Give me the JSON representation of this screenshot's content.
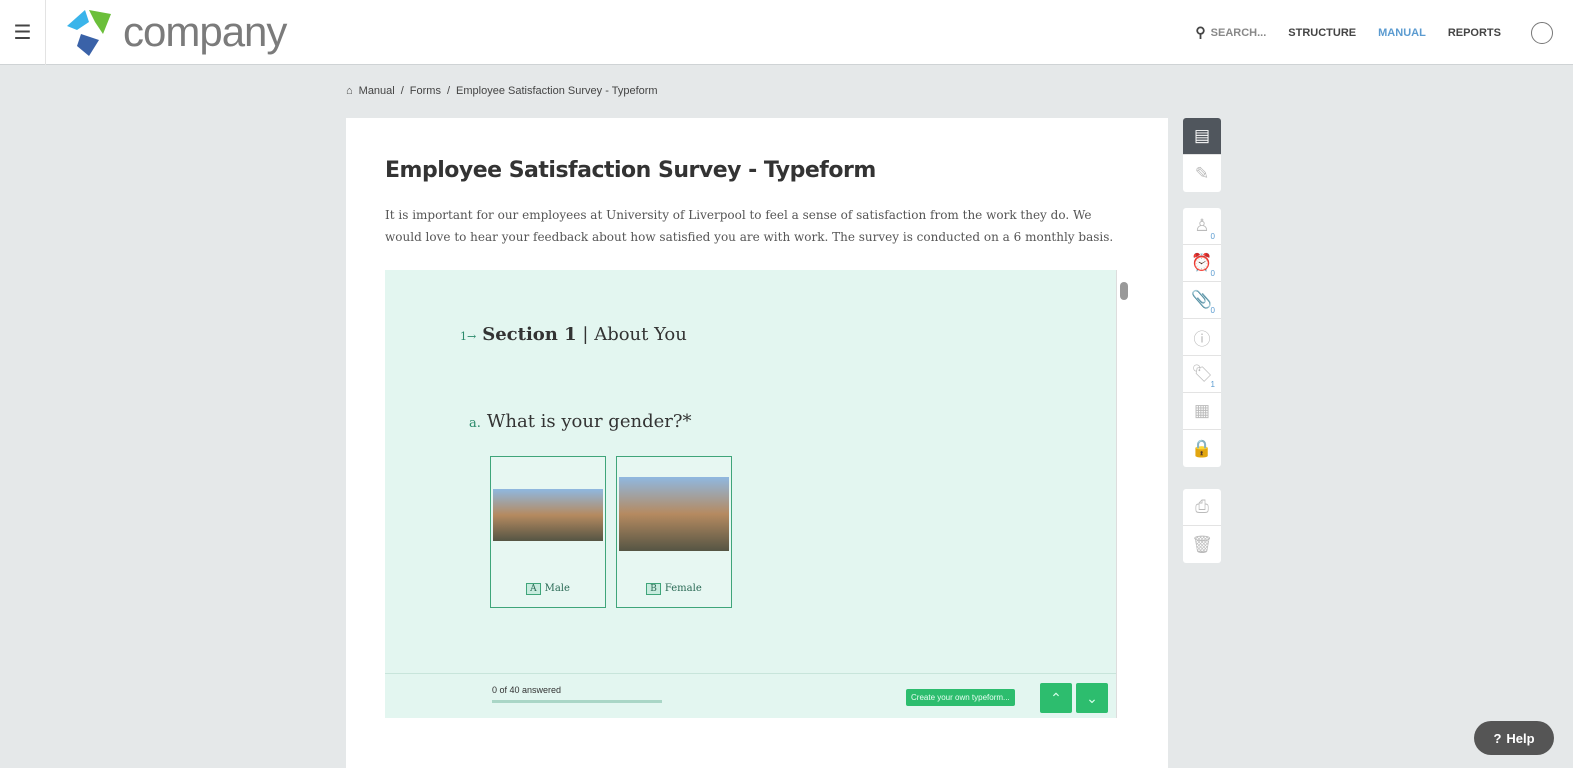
{
  "header": {
    "brand": "company",
    "search": "SEARCH...",
    "nav": [
      "STRUCTURE",
      "MANUAL",
      "REPORTS"
    ]
  },
  "breadcrumb": [
    "Manual",
    "/",
    "Forms",
    "/",
    "Employee Satisfaction Survey - Typeform"
  ],
  "page": {
    "title": "Employee Satisfaction Survey - Typeform",
    "description": "It is important for our employees at University of Liverpool to feel a sense of satisfaction from the work they do. We would love to hear your feedback about how satisfied you are with work. The survey is conducted on a 6 monthly basis."
  },
  "form": {
    "section_num": "1→",
    "section_bold": "Section 1",
    "section_rest": "| About You",
    "question_num": "a.",
    "question": "What is your gender?*",
    "options": [
      {
        "key": "A",
        "label": "Male"
      },
      {
        "key": "B",
        "label": "Female"
      }
    ],
    "progress_text": "0 of 40 answered",
    "progress": 0,
    "create": "Create your own typeform...",
    "up": "⌃",
    "down": "⌄"
  },
  "sidebar": {
    "counts": {
      "users": "0",
      "reminders": "0",
      "attachments": "0",
      "tags": "1"
    }
  },
  "help": "Help"
}
